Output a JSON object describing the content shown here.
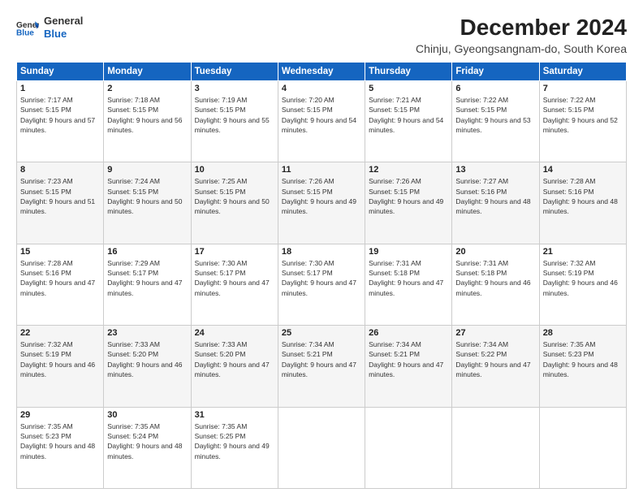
{
  "logo": {
    "line1": "General",
    "line2": "Blue"
  },
  "title": "December 2024",
  "location": "Chinju, Gyeongsangnam-do, South Korea",
  "weekdays": [
    "Sunday",
    "Monday",
    "Tuesday",
    "Wednesday",
    "Thursday",
    "Friday",
    "Saturday"
  ],
  "days": [
    {
      "date": "",
      "info": ""
    },
    {
      "date": "",
      "info": ""
    },
    {
      "date": "",
      "info": ""
    },
    {
      "date": "",
      "info": ""
    },
    {
      "date": "5",
      "sunrise": "Sunrise: 7:21 AM",
      "sunset": "Sunset: 5:15 PM",
      "daylight": "Daylight: 9 hours and 54 minutes."
    },
    {
      "date": "6",
      "sunrise": "Sunrise: 7:22 AM",
      "sunset": "Sunset: 5:15 PM",
      "daylight": "Daylight: 9 hours and 53 minutes."
    },
    {
      "date": "7",
      "sunrise": "Sunrise: 7:22 AM",
      "sunset": "Sunset: 5:15 PM",
      "daylight": "Daylight: 9 hours and 52 minutes."
    },
    {
      "date": "1",
      "sunrise": "Sunrise: 7:17 AM",
      "sunset": "Sunset: 5:15 PM",
      "daylight": "Daylight: 9 hours and 57 minutes."
    },
    {
      "date": "2",
      "sunrise": "Sunrise: 7:18 AM",
      "sunset": "Sunset: 5:15 PM",
      "daylight": "Daylight: 9 hours and 56 minutes."
    },
    {
      "date": "3",
      "sunrise": "Sunrise: 7:19 AM",
      "sunset": "Sunset: 5:15 PM",
      "daylight": "Daylight: 9 hours and 55 minutes."
    },
    {
      "date": "4",
      "sunrise": "Sunrise: 7:20 AM",
      "sunset": "Sunset: 5:15 PM",
      "daylight": "Daylight: 9 hours and 54 minutes."
    }
  ],
  "rows": [
    {
      "cells": [
        {
          "date": "1",
          "sunrise": "Sunrise: 7:17 AM",
          "sunset": "Sunset: 5:15 PM",
          "daylight": "Daylight: 9 hours and 57 minutes."
        },
        {
          "date": "2",
          "sunrise": "Sunrise: 7:18 AM",
          "sunset": "Sunset: 5:15 PM",
          "daylight": "Daylight: 9 hours and 56 minutes."
        },
        {
          "date": "3",
          "sunrise": "Sunrise: 7:19 AM",
          "sunset": "Sunset: 5:15 PM",
          "daylight": "Daylight: 9 hours and 55 minutes."
        },
        {
          "date": "4",
          "sunrise": "Sunrise: 7:20 AM",
          "sunset": "Sunset: 5:15 PM",
          "daylight": "Daylight: 9 hours and 54 minutes."
        },
        {
          "date": "5",
          "sunrise": "Sunrise: 7:21 AM",
          "sunset": "Sunset: 5:15 PM",
          "daylight": "Daylight: 9 hours and 54 minutes."
        },
        {
          "date": "6",
          "sunrise": "Sunrise: 7:22 AM",
          "sunset": "Sunset: 5:15 PM",
          "daylight": "Daylight: 9 hours and 53 minutes."
        },
        {
          "date": "7",
          "sunrise": "Sunrise: 7:22 AM",
          "sunset": "Sunset: 5:15 PM",
          "daylight": "Daylight: 9 hours and 52 minutes."
        }
      ]
    },
    {
      "cells": [
        {
          "date": "8",
          "sunrise": "Sunrise: 7:23 AM",
          "sunset": "Sunset: 5:15 PM",
          "daylight": "Daylight: 9 hours and 51 minutes."
        },
        {
          "date": "9",
          "sunrise": "Sunrise: 7:24 AM",
          "sunset": "Sunset: 5:15 PM",
          "daylight": "Daylight: 9 hours and 50 minutes."
        },
        {
          "date": "10",
          "sunrise": "Sunrise: 7:25 AM",
          "sunset": "Sunset: 5:15 PM",
          "daylight": "Daylight: 9 hours and 50 minutes."
        },
        {
          "date": "11",
          "sunrise": "Sunrise: 7:26 AM",
          "sunset": "Sunset: 5:15 PM",
          "daylight": "Daylight: 9 hours and 49 minutes."
        },
        {
          "date": "12",
          "sunrise": "Sunrise: 7:26 AM",
          "sunset": "Sunset: 5:15 PM",
          "daylight": "Daylight: 9 hours and 49 minutes."
        },
        {
          "date": "13",
          "sunrise": "Sunrise: 7:27 AM",
          "sunset": "Sunset: 5:16 PM",
          "daylight": "Daylight: 9 hours and 48 minutes."
        },
        {
          "date": "14",
          "sunrise": "Sunrise: 7:28 AM",
          "sunset": "Sunset: 5:16 PM",
          "daylight": "Daylight: 9 hours and 48 minutes."
        }
      ]
    },
    {
      "cells": [
        {
          "date": "15",
          "sunrise": "Sunrise: 7:28 AM",
          "sunset": "Sunset: 5:16 PM",
          "daylight": "Daylight: 9 hours and 47 minutes."
        },
        {
          "date": "16",
          "sunrise": "Sunrise: 7:29 AM",
          "sunset": "Sunset: 5:17 PM",
          "daylight": "Daylight: 9 hours and 47 minutes."
        },
        {
          "date": "17",
          "sunrise": "Sunrise: 7:30 AM",
          "sunset": "Sunset: 5:17 PM",
          "daylight": "Daylight: 9 hours and 47 minutes."
        },
        {
          "date": "18",
          "sunrise": "Sunrise: 7:30 AM",
          "sunset": "Sunset: 5:17 PM",
          "daylight": "Daylight: 9 hours and 47 minutes."
        },
        {
          "date": "19",
          "sunrise": "Sunrise: 7:31 AM",
          "sunset": "Sunset: 5:18 PM",
          "daylight": "Daylight: 9 hours and 47 minutes."
        },
        {
          "date": "20",
          "sunrise": "Sunrise: 7:31 AM",
          "sunset": "Sunset: 5:18 PM",
          "daylight": "Daylight: 9 hours and 46 minutes."
        },
        {
          "date": "21",
          "sunrise": "Sunrise: 7:32 AM",
          "sunset": "Sunset: 5:19 PM",
          "daylight": "Daylight: 9 hours and 46 minutes."
        }
      ]
    },
    {
      "cells": [
        {
          "date": "22",
          "sunrise": "Sunrise: 7:32 AM",
          "sunset": "Sunset: 5:19 PM",
          "daylight": "Daylight: 9 hours and 46 minutes."
        },
        {
          "date": "23",
          "sunrise": "Sunrise: 7:33 AM",
          "sunset": "Sunset: 5:20 PM",
          "daylight": "Daylight: 9 hours and 46 minutes."
        },
        {
          "date": "24",
          "sunrise": "Sunrise: 7:33 AM",
          "sunset": "Sunset: 5:20 PM",
          "daylight": "Daylight: 9 hours and 47 minutes."
        },
        {
          "date": "25",
          "sunrise": "Sunrise: 7:34 AM",
          "sunset": "Sunset: 5:21 PM",
          "daylight": "Daylight: 9 hours and 47 minutes."
        },
        {
          "date": "26",
          "sunrise": "Sunrise: 7:34 AM",
          "sunset": "Sunset: 5:21 PM",
          "daylight": "Daylight: 9 hours and 47 minutes."
        },
        {
          "date": "27",
          "sunrise": "Sunrise: 7:34 AM",
          "sunset": "Sunset: 5:22 PM",
          "daylight": "Daylight: 9 hours and 47 minutes."
        },
        {
          "date": "28",
          "sunrise": "Sunrise: 7:35 AM",
          "sunset": "Sunset: 5:23 PM",
          "daylight": "Daylight: 9 hours and 48 minutes."
        }
      ]
    },
    {
      "cells": [
        {
          "date": "29",
          "sunrise": "Sunrise: 7:35 AM",
          "sunset": "Sunset: 5:23 PM",
          "daylight": "Daylight: 9 hours and 48 minutes."
        },
        {
          "date": "30",
          "sunrise": "Sunrise: 7:35 AM",
          "sunset": "Sunset: 5:24 PM",
          "daylight": "Daylight: 9 hours and 48 minutes."
        },
        {
          "date": "31",
          "sunrise": "Sunrise: 7:35 AM",
          "sunset": "Sunset: 5:25 PM",
          "daylight": "Daylight: 9 hours and 49 minutes."
        },
        {
          "date": "",
          "sunrise": "",
          "sunset": "",
          "daylight": ""
        },
        {
          "date": "",
          "sunrise": "",
          "sunset": "",
          "daylight": ""
        },
        {
          "date": "",
          "sunrise": "",
          "sunset": "",
          "daylight": ""
        },
        {
          "date": "",
          "sunrise": "",
          "sunset": "",
          "daylight": ""
        }
      ]
    }
  ]
}
